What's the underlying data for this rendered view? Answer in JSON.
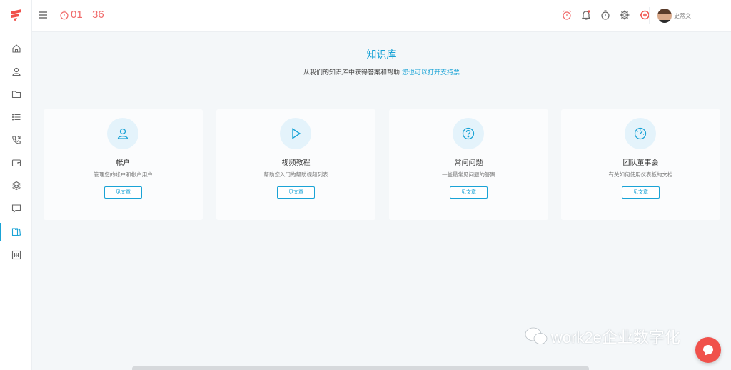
{
  "header": {
    "timer_hours": "01",
    "timer_minutes": "36",
    "user_name": "史蒂文"
  },
  "sidebar": {
    "items": [
      {
        "icon": "home-icon"
      },
      {
        "icon": "contacts-icon"
      },
      {
        "icon": "folder-icon"
      },
      {
        "icon": "list-icon"
      },
      {
        "icon": "phone-icon"
      },
      {
        "icon": "wallet-icon"
      },
      {
        "icon": "layers-icon"
      },
      {
        "icon": "chat-icon"
      },
      {
        "icon": "knowledge-icon",
        "active": true
      },
      {
        "icon": "sliders-icon"
      }
    ]
  },
  "main": {
    "title": "知识库",
    "subtitle": "从我们的知识库中获得答案和帮助",
    "subtitle_link": "您也可以打开支持票"
  },
  "cards": [
    {
      "icon": "user-icon",
      "title": "帐户",
      "desc": "管理您的帐户和帐户用户",
      "button": "见文章"
    },
    {
      "icon": "play-icon",
      "title": "视频教程",
      "desc": "帮助您入门的帮助视频列表",
      "button": "见文章"
    },
    {
      "icon": "question-icon",
      "title": "常问问题",
      "desc": "一些最常见问题的答案",
      "button": "见文章"
    },
    {
      "icon": "dashboard-icon",
      "title": "团队董事会",
      "desc": "有关如何使用仪表板的文档",
      "button": "见文章"
    }
  ],
  "watermark": "work2e企业数字化",
  "colors": {
    "accent": "#1aa3d6",
    "danger": "#f0514b",
    "timer": "#f06a6a"
  }
}
